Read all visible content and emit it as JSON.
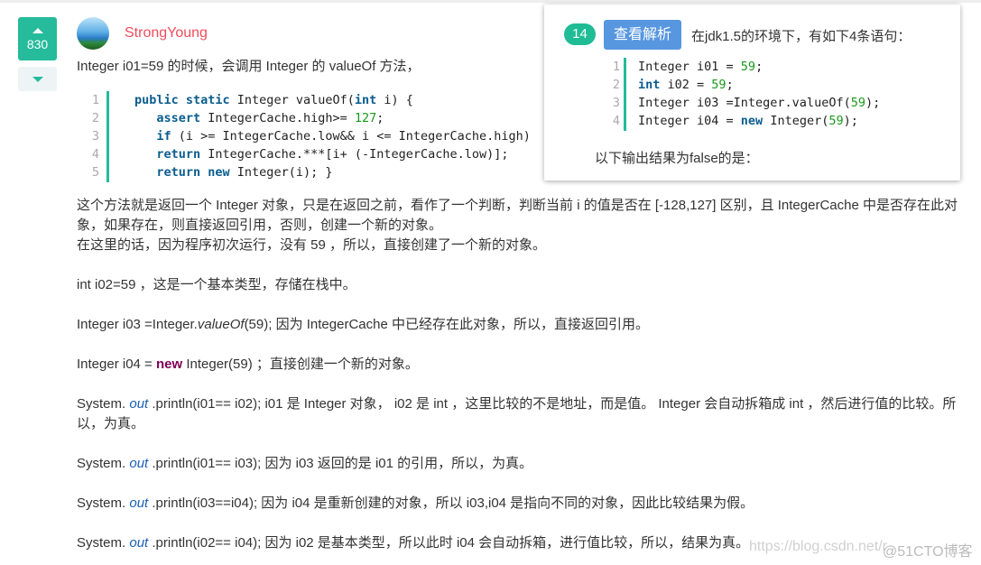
{
  "vote": {
    "count": "830"
  },
  "user": {
    "name": "StrongYoung"
  },
  "answer": {
    "intro": "Integer i01=59 的时候，会调用 Integer 的 valueOf 方法，",
    "code_lines": [
      "1",
      "2",
      "3",
      "4",
      "5"
    ],
    "code": [
      [
        "",
        "public static",
        " Integer valueOf(",
        "int",
        " i) {"
      ],
      [
        "   ",
        "assert",
        " IntegerCache.high>= ",
        "127",
        ";"
      ],
      [
        "   ",
        "if",
        " (i >= IntegerCache.low&& i <= IntegerCache.high)"
      ],
      [
        "   ",
        "return",
        " IntegerCache.***[i+ (-IntegerCache.low)];"
      ],
      [
        "   ",
        "return new",
        " Integer(i); }"
      ]
    ],
    "p1": "这个方法就是返回一个 Integer 对象，只是在返回之前，看作了一个判断，判断当前 i 的值是否在 [-128,127] 区别，且 IntegerCache 中是否存在此对象，如果存在，则直接返回引用，否则，创建一个新的对象。",
    "p1b": "在这里的话，因为程序初次运行，没有 59 ，所以，直接创建了一个新的对象。",
    "p2": "int i02=59 ，这是一个基本类型，存储在栈中。",
    "p3a": "Integer i03 =Integer.",
    "p3b": "valueOf",
    "p3c": "(59); 因为 IntegerCache 中已经存在此对象，所以，直接返回引用。",
    "p4a": "Integer i04 = ",
    "p4b": "new",
    "p4c": " Integer(59) ；直接创建一个新的对象。",
    "sys": "System. ",
    "out": "out",
    "p5": " .println(i01== i02); i01 是 Integer 对象， i02 是 int ，这里比较的不是地址，而是值。 Integer 会自动拆箱成 int ，然后进行值的比较。所以，为真。",
    "p6": " .println(i01== i03); 因为 i03 返回的是 i01 的引用，所以，为真。",
    "p7": " .println(i03==i04); 因为 i04 是重新创建的对象，所以 i03,i04 是指向不同的对象，因此比较结果为假。",
    "p8": " .println(i02== i04); 因为 i02 是基本类型，所以此时 i04 会自动拆箱，进行值比较，所以，结果为真。"
  },
  "question": {
    "number": "14",
    "button": "查看解析",
    "title": "在jdk1.5的环境下，有如下4条语句：",
    "code_lines": [
      "1",
      "2",
      "3",
      "4"
    ],
    "prompt": "以下输出结果为false的是："
  },
  "watermark": {
    "url": "https://blog.csdn.net/r",
    "site": "@51CTO博客"
  }
}
